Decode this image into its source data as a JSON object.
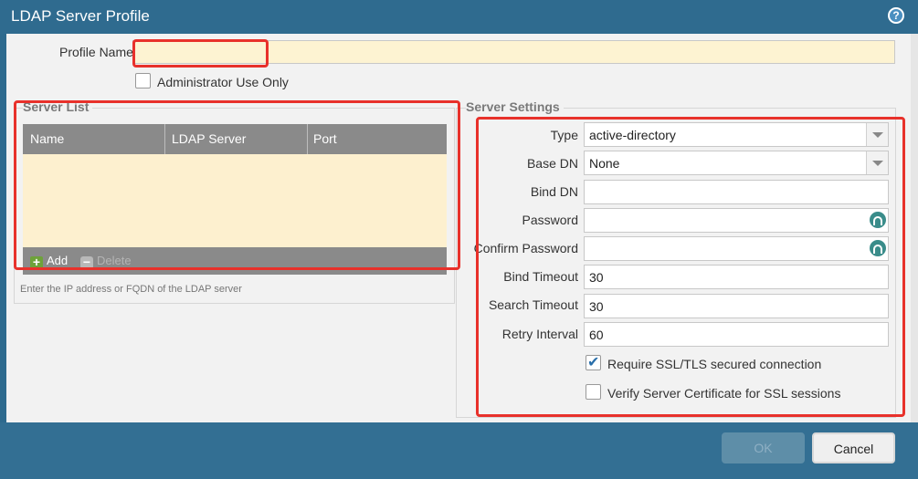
{
  "dialog": {
    "title": "LDAP Server Profile",
    "help_icon": "question-icon"
  },
  "profile": {
    "name_label": "Profile Name",
    "name_value": "",
    "admin_only_label": "Administrator Use Only",
    "admin_only_checked": false
  },
  "server_list": {
    "title": "Server List",
    "columns": [
      "Name",
      "LDAP Server",
      "Port"
    ],
    "rows": [],
    "add_label": "Add",
    "delete_label": "Delete",
    "hint": "Enter the IP address or FQDN of the LDAP server"
  },
  "server_settings": {
    "title": "Server Settings",
    "type_label": "Type",
    "type_value": "active-directory",
    "base_dn_label": "Base DN",
    "base_dn_value": "None",
    "bind_dn_label": "Bind DN",
    "bind_dn_value": "",
    "password_label": "Password",
    "password_value": "",
    "confirm_password_label": "Confirm Password",
    "confirm_password_value": "",
    "bind_timeout_label": "Bind Timeout",
    "bind_timeout_value": "30",
    "search_timeout_label": "Search Timeout",
    "search_timeout_value": "30",
    "retry_interval_label": "Retry Interval",
    "retry_interval_value": "60",
    "require_ssl_label": "Require SSL/TLS secured connection",
    "require_ssl_checked": true,
    "verify_cert_label": "Verify Server Certificate for SSL sessions",
    "verify_cert_checked": false
  },
  "footer": {
    "ok_label": "OK",
    "cancel_label": "Cancel"
  },
  "colors": {
    "titlebar": "#2f6b8f",
    "highlight": "#e8312b",
    "field_yellow": "#fdf3d2"
  }
}
